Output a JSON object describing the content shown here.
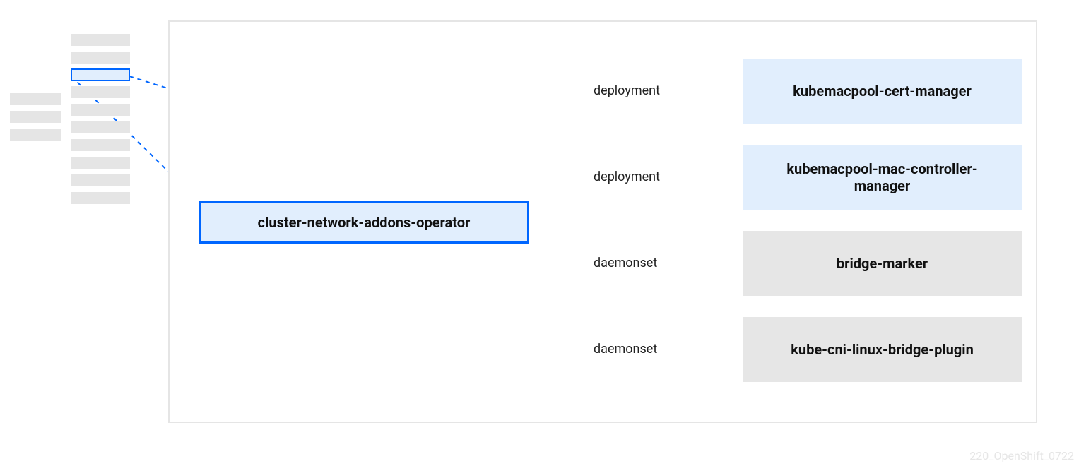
{
  "operator": {
    "label": "cluster-network-addons-operator"
  },
  "connections": [
    {
      "label": "deployment",
      "target": "kubemacpool-cert-manager",
      "style": "blue"
    },
    {
      "label": "deployment",
      "target": "kubemacpool-mac-controller-manager",
      "style": "blue"
    },
    {
      "label": "daemonset",
      "target": "bridge-marker",
      "style": "grey"
    },
    {
      "label": "daemonset",
      "target": "kube-cni-linux-bridge-plugin",
      "style": "grey"
    }
  ],
  "footer": {
    "id": "220_OpenShift_0722"
  },
  "colors": {
    "blue": "#0066ff",
    "grey_block": "#e5e5e5",
    "target_grey": "#e6e6e6",
    "target_blue_bg": "#e1eefd"
  }
}
